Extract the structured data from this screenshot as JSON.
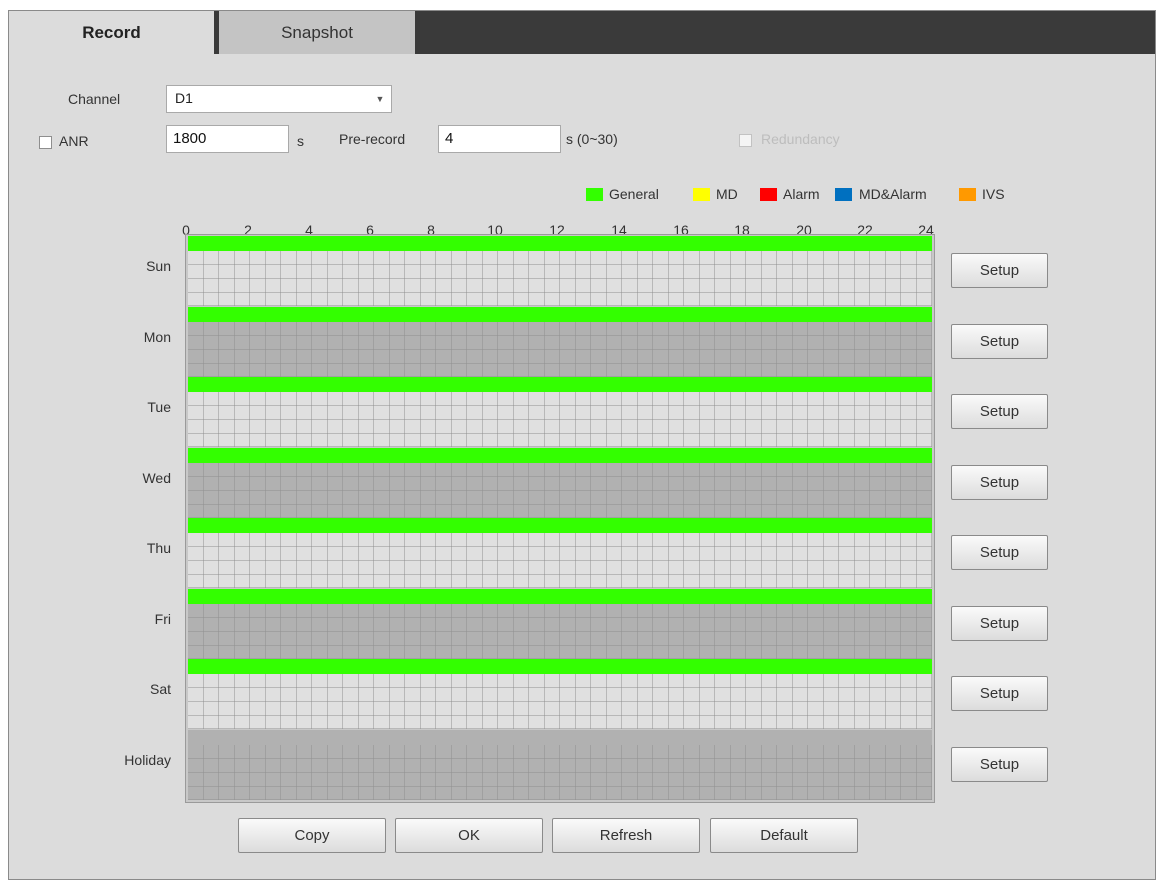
{
  "tabs": [
    {
      "label": "Record",
      "active": true
    },
    {
      "label": "Snapshot",
      "active": false
    }
  ],
  "form": {
    "channel_label": "Channel",
    "channel_value": "D1",
    "anr_label": "ANR",
    "anr_value": "1800",
    "anr_unit": "s",
    "prerecord_label": "Pre-record",
    "prerecord_value": "4",
    "prerecord_unit": "s (0~30)",
    "redundancy_label": "Redundancy"
  },
  "legend": [
    {
      "label": "General",
      "color": "#33ff00"
    },
    {
      "label": "MD",
      "color": "#ffff00"
    },
    {
      "label": "Alarm",
      "color": "#ff0000"
    },
    {
      "label": "MD&Alarm",
      "color": "#0070c0"
    },
    {
      "label": "IVS",
      "color": "#ff9900"
    }
  ],
  "hours": [
    "0",
    "2",
    "4",
    "6",
    "8",
    "10",
    "12",
    "14",
    "16",
    "18",
    "20",
    "22",
    "24"
  ],
  "days": [
    {
      "label": "Sun",
      "general_hours": [
        0,
        24
      ]
    },
    {
      "label": "Mon",
      "general_hours": [
        0,
        24
      ]
    },
    {
      "label": "Tue",
      "general_hours": [
        0,
        24
      ]
    },
    {
      "label": "Wed",
      "general_hours": [
        0,
        24
      ]
    },
    {
      "label": "Thu",
      "general_hours": [
        0,
        24
      ]
    },
    {
      "label": "Fri",
      "general_hours": [
        0,
        24
      ]
    },
    {
      "label": "Sat",
      "general_hours": [
        0,
        24
      ]
    },
    {
      "label": "Holiday",
      "general_hours": null
    }
  ],
  "setup_label": "Setup",
  "buttons": {
    "copy": "Copy",
    "ok": "OK",
    "refresh": "Refresh",
    "default": "Default"
  }
}
